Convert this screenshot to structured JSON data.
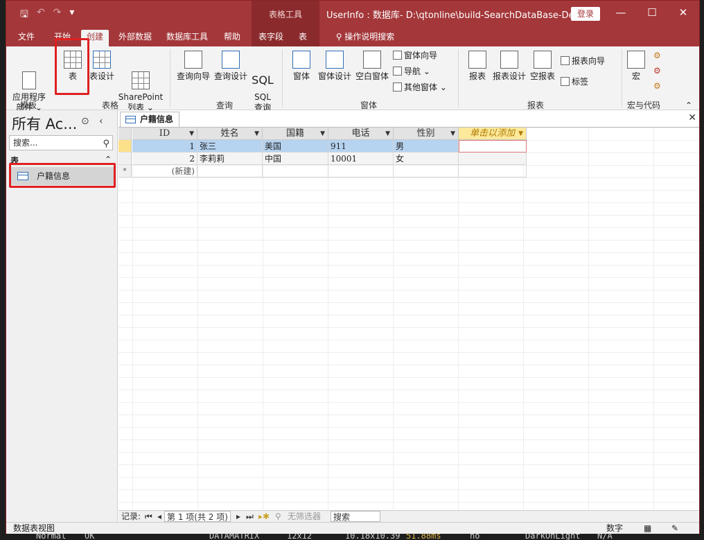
{
  "window": {
    "title": "UserInfo : 数据库- D:\\qtonline\\build-SearchDataBase-Des...",
    "context_tools_label": "表格工具",
    "login_label": "登录",
    "minimize": "—",
    "maximize": "☐",
    "close": "✕"
  },
  "tabs": [
    "文件",
    "开始",
    "创建",
    "外部数据",
    "数据库工具",
    "帮助",
    "表字段",
    "表"
  ],
  "tell_me": "操作说明搜索",
  "ribbon": {
    "app_parts": "应用程序\n部件 ⌄",
    "table": "表",
    "table_design": "表设计",
    "sharepoint": "SharePoint\n列表 ⌄",
    "query_wizard": "查询向导",
    "query_design": "查询设计",
    "sql_icon": "SQL",
    "sql_query": "SQL\n查询",
    "form": "窗体",
    "form_design": "窗体设计",
    "blank_form": "空白窗体",
    "form_wizard": "窗体向导",
    "navigation": "导航 ⌄",
    "more_forms": "其他窗体 ⌄",
    "report": "报表",
    "report_design": "报表设计",
    "blank_report": "空报表",
    "report_wizard": "报表向导",
    "labels": "标签",
    "macro": "宏",
    "groups": {
      "templates": "模板",
      "tables": "表格",
      "queries": "查询",
      "forms": "窗体",
      "reports": "报表",
      "macros_code": "宏与代码"
    }
  },
  "nav_pane": {
    "title": "所有 Ac...",
    "search_placeholder": "搜索...",
    "section": "表",
    "items": [
      "户籍信息"
    ]
  },
  "document": {
    "tab": "户籍信息",
    "columns": [
      "ID",
      "姓名",
      "国籍",
      "电话",
      "性别",
      "单击以添加"
    ],
    "rows": [
      [
        "1",
        "张三",
        "美国",
        "911",
        "男"
      ],
      [
        "2",
        "李莉莉",
        "中国",
        "10001",
        "女"
      ]
    ],
    "new_row": "(新建)",
    "new_marker": "*"
  },
  "record_nav": {
    "label": "记录:",
    "position": "第 1 项(共 2 项)",
    "filter": "无筛选器",
    "search": "搜索"
  },
  "status": {
    "left": "数据表视图",
    "right": "数字"
  },
  "bottom_strip": {
    "a": "Normal",
    "b": "OK",
    "c": "DATAMATRIX",
    "d": "12x12",
    "e": "10.18x10.39",
    "f": "51.88ms",
    "g": "no",
    "h": "DarkOnLight",
    "i": "N/A"
  }
}
